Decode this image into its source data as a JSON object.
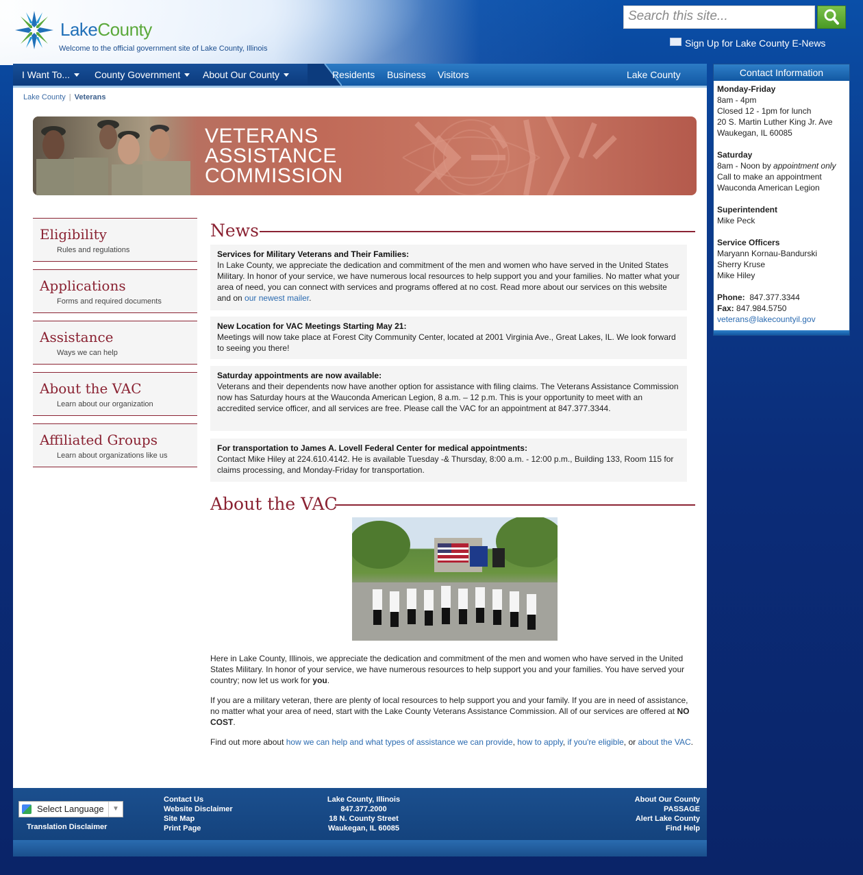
{
  "header": {
    "logo_name_part1": "Lake",
    "logo_name_part2": "County",
    "tagline": "Welcome to the official government site of Lake County, Illinois",
    "search_placeholder": "Search this site...",
    "enews_label": "Sign Up for Lake County E-News"
  },
  "nav": {
    "left": [
      {
        "label": "I Want To..."
      },
      {
        "label": "County Government"
      },
      {
        "label": "About Our County"
      }
    ],
    "right": [
      {
        "label": "Residents"
      },
      {
        "label": "Business"
      },
      {
        "label": "Visitors"
      }
    ],
    "site_label": "Lake County"
  },
  "breadcrumb": {
    "home": "Lake County",
    "sep": "|",
    "current": "Veterans"
  },
  "banner": {
    "line1": "VETERANS",
    "line2": "ASSISTANCE",
    "line3": "COMMISSION"
  },
  "menu": [
    {
      "label": "Eligibility",
      "sub": "Rules and regulations"
    },
    {
      "label": "Applications",
      "sub": "Forms and required documents"
    },
    {
      "label": "Assistance",
      "sub": "Ways we can help"
    },
    {
      "label": "About the VAC",
      "sub": "Learn about our organization"
    },
    {
      "label": "Affiliated Groups",
      "sub": "Learn about organizations like us"
    }
  ],
  "news": {
    "heading": "News",
    "items": [
      {
        "title": "Services for Military Veterans and Their Families:",
        "body": "In Lake County, we appreciate the dedication and commitment of the men and women who have served in the United States Military. In honor of your service, we have numerous local resources to help support you and your families. No matter what your area of need, you can connect with services and programs offered at no cost. Read more about our services on this website and on ",
        "link": "our newest mailer",
        "tail": "."
      },
      {
        "title": "New Location for VAC Meetings Starting May 21:",
        "body": "Meetings will now take place at Forest City Community Center, located at 2001 Virginia Ave., Great Lakes, IL.  We look forward to seeing you there!"
      },
      {
        "title": "Saturday appointments are now available:",
        "body": "Veterans and their dependents now have another option for assistance with filing claims. The Veterans Assistance Commission now has Saturday hours at the Wauconda American Legion, 8 a.m. – 12 p.m. This is your opportunity to meet with an accredited service officer, and all services are free. Please call the VAC for an appointment at 847.377.3344."
      },
      {
        "title": "For transportation to James A. Lovell Federal Center for medical appointments:",
        "body": "Contact Mike Hiley at 224.610.4142.  He is available Tuesday -& Thursday, 8:00 a.m. - 12:00 p.m., Building 133, Room 115 for claims processing, and Monday-Friday for transportation."
      }
    ]
  },
  "about": {
    "heading": "About the VAC",
    "p1": "Here in Lake County, Illinois, we appreciate the dedication and commitment of the men and women who have served in the United States Military. In honor of your service, we have numerous resources to help support you and your families. You have served your country; now let us work for ",
    "p1_bold": "you",
    "p1_end": ".",
    "p2": "If you are a military veteran, there are plenty of local resources to help support you and your family. If you are in need of assistance, no matter what your area of need, start with the Lake County Veterans Assistance Commission. All of our services are offered at ",
    "p2_bold": "NO COST",
    "p2_end": ".",
    "p3_intro": "Find out more about ",
    "p3_link1": "how we can help and what types of assistance we can provide",
    "p3_c1": ", ",
    "p3_link2": "how to apply",
    "p3_c2": ", ",
    "p3_link3": "if you're eligible",
    "p3_c3": ", or ",
    "p3_link4": "about the VAC",
    "p3_end": "."
  },
  "contact": {
    "heading": "Contact Information",
    "weekday_title": "Monday-Friday",
    "weekday_hours": "8am - 4pm",
    "weekday_lunch": "Closed 12 - 1pm for lunch",
    "address1": "20 S. Martin Luther King Jr. Ave",
    "address2": "Waukegan, IL 60085",
    "saturday_title": "Saturday",
    "saturday_hours": "8am - Noon by ",
    "saturday_hours_em": "appointment only",
    "saturday_call": "Call to make an appointment",
    "saturday_place": "Wauconda American Legion",
    "super_title": "Superintendent",
    "super_name": "Mike Peck",
    "officers_title": "Service Officers",
    "officers": [
      "Maryann Kornau-Bandurski",
      "Sherry Kruse",
      "Mike Hiley"
    ],
    "phone_label": "Phone:",
    "phone": "847.377.3344",
    "fax_label": "Fax:",
    "fax": "847.984.5750",
    "email": "veterans@lakecountyil.gov"
  },
  "footer": {
    "language": "Select Language",
    "translation": "Translation Disclaimer",
    "links": [
      "Contact Us",
      "Website Disclaimer",
      "Site Map",
      "Print Page"
    ],
    "address": [
      "Lake County, Illinois",
      "847.377.2000",
      "18 N. County Street",
      "Waukegan, IL 60085"
    ],
    "right_links": [
      "About Our County",
      "PASSAGE",
      "Alert Lake County",
      "Find Help"
    ]
  },
  "colors": {
    "accent": "#8a2232",
    "link": "#2a6ab0",
    "nav": "#1259a4",
    "brand_green": "#5aa83a"
  }
}
